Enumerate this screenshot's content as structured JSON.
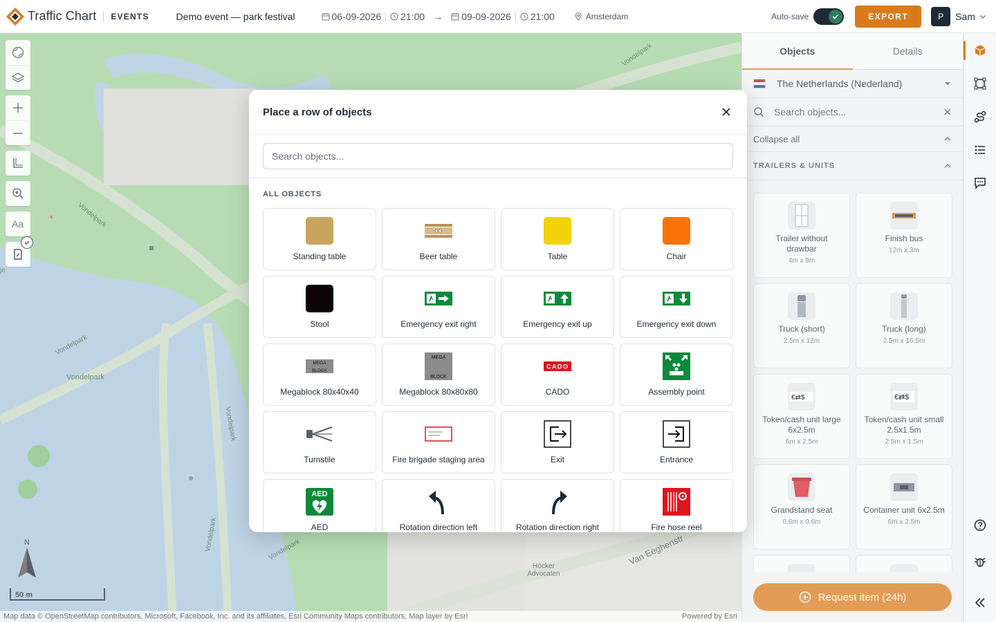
{
  "app": {
    "name": "Traffic Chart",
    "sub": "EVENTS",
    "event_title": "Demo event — park festival",
    "start_date": "06-09-2026",
    "start_time": "21:00",
    "end_date": "09-09-2026",
    "end_time": "21:00",
    "location": "Amsterdam",
    "autosave_label": "Auto-save",
    "autosave_on": true,
    "export_label": "EXPORT",
    "user_initial": "P",
    "user_name": "Sam",
    "brand_color": "#d97b1c"
  },
  "map": {
    "labels": [
      "Vondelpark",
      "Vondelpark",
      "Vondelpark",
      "Vondelpark",
      "Vondelpark",
      "Vondelpark",
      "Vondelpark",
      "Van Eeghenstr",
      "Höcker Advocaten",
      "je"
    ],
    "compass_label": "N",
    "scale_label": "50 m",
    "attribution": "Map data © OpenStreetMap contributors, Microsoft, Facebook, Inc. and its affiliates, Esri Community Maps contributors, Map layer by Esri",
    "powered_by": "Powered by Esri"
  },
  "modal": {
    "title": "Place a row of objects",
    "search_placeholder": "Search objects...",
    "section_label": "ALL OBJECTS",
    "objects": [
      {
        "label": "Standing table",
        "icon": "standing-table-icon"
      },
      {
        "label": "Beer table",
        "icon": "beer-table-icon"
      },
      {
        "label": "Table",
        "icon": "table-icon"
      },
      {
        "label": "Chair",
        "icon": "chair-icon"
      },
      {
        "label": "Stool",
        "icon": "stool-icon"
      },
      {
        "label": "Emergency exit right",
        "icon": "emergency-exit-right-icon"
      },
      {
        "label": "Emergency exit up",
        "icon": "emergency-exit-up-icon"
      },
      {
        "label": "Emergency exit down",
        "icon": "emergency-exit-down-icon"
      },
      {
        "label": "Megablock 80x40x40",
        "icon": "megablock-small-icon"
      },
      {
        "label": "Megablock 80x80x80",
        "icon": "megablock-large-icon"
      },
      {
        "label": "CADO",
        "icon": "cado-icon"
      },
      {
        "label": "Assembly point",
        "icon": "assembly-point-icon"
      },
      {
        "label": "Turnstile",
        "icon": "turnstile-icon"
      },
      {
        "label": "Fire brigade staging area",
        "icon": "fire-brigade-staging-icon"
      },
      {
        "label": "Exit",
        "icon": "exit-icon"
      },
      {
        "label": "Entrance",
        "icon": "entrance-icon"
      },
      {
        "label": "AED",
        "icon": "aed-icon"
      },
      {
        "label": "Rotation direction left",
        "icon": "rotation-left-icon"
      },
      {
        "label": "Rotation direction right",
        "icon": "rotation-right-icon"
      },
      {
        "label": "Fire hose reel",
        "icon": "fire-hose-reel-icon"
      }
    ],
    "icon_text": {
      "megablock": "MEGA",
      "megablock_bottom": "BLOCK",
      "cado": "CADO",
      "aed": "AED"
    }
  },
  "panel": {
    "tabs": [
      "Objects",
      "Details"
    ],
    "active_tab": "Objects",
    "country": "The Netherlands (Nederland)",
    "search_placeholder": "Search objects...",
    "collapse_label": "Collapse all",
    "category": "TRAILERS & UNITS",
    "items": [
      {
        "name": "Trailer without drawbar",
        "size": "4m x 8m",
        "icon": "trailer-icon"
      },
      {
        "name": "Finish bus",
        "size": "12m x 3m",
        "icon": "finish-bus-icon"
      },
      {
        "name": "Truck (short)",
        "size": "2.5m x 12m",
        "icon": "truck-short-icon"
      },
      {
        "name": "Truck (long)",
        "size": "2.5m x 16.5m",
        "icon": "truck-long-icon"
      },
      {
        "name": "Token/cash unit large 6x2.5m",
        "size": "6m x 2.5m",
        "icon": "token-unit-large-icon"
      },
      {
        "name": "Token/cash unit small 2.5x1.5m",
        "size": "2.5m x 1.5m",
        "icon": "token-unit-small-icon"
      },
      {
        "name": "Grandstand seat",
        "size": "0.6m x 0.6m",
        "icon": "grandstand-seat-icon"
      },
      {
        "name": "Container unit 6x2.5m",
        "size": "6m x 2.5m",
        "icon": "container-unit-icon"
      },
      {
        "name": "",
        "size": "",
        "icon": "unit-icon"
      },
      {
        "name": "",
        "size": "",
        "icon": "unit-icon"
      }
    ],
    "request_label": "Request item (24h)"
  }
}
